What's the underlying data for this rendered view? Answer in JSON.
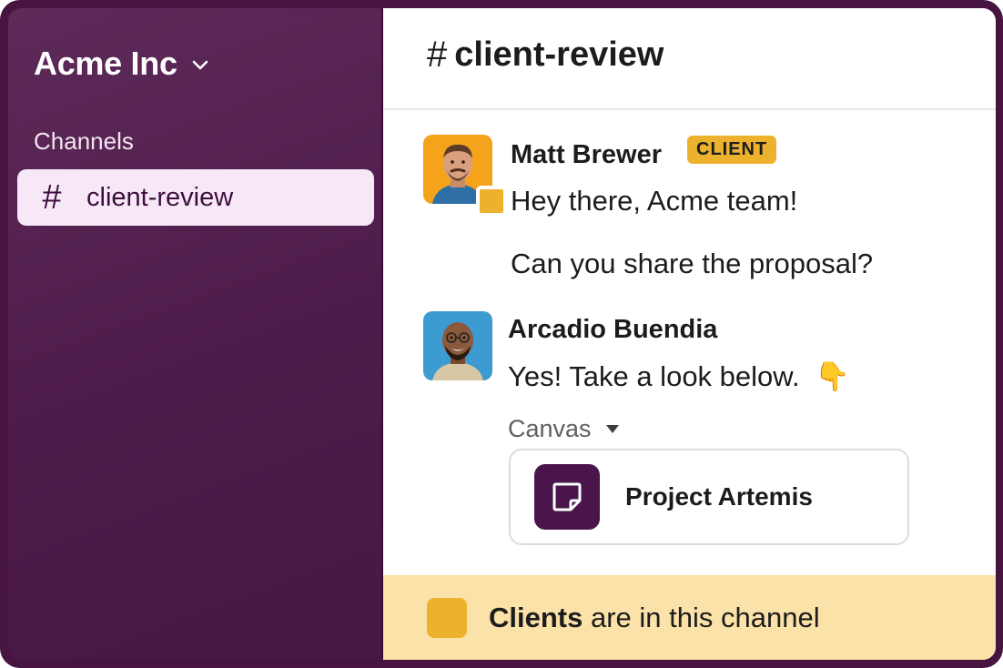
{
  "workspace": {
    "name": "Acme Inc"
  },
  "sidebar": {
    "section_label": "Channels",
    "channels": [
      {
        "hash": "#",
        "name": "client-review",
        "active": true
      }
    ]
  },
  "channel_header": {
    "hash": "#",
    "title": "client-review"
  },
  "messages": [
    {
      "author": "Matt Brewer",
      "tag": "CLIENT",
      "lines": [
        "Hey there, Acme team!",
        "Can you share the proposal?"
      ]
    },
    {
      "author": "Arcadio Buendia",
      "lines": [
        "Yes! Take a look below."
      ],
      "emoji": "👇",
      "attachment_toggle": "Canvas",
      "attachment": {
        "title": "Project Artemis"
      }
    }
  ],
  "footer": {
    "bold": "Clients",
    "rest": " are in this channel"
  },
  "colors": {
    "sidebar_bg": "#4e1c4a",
    "active_channel_bg": "#f6e8f6",
    "client_accent": "#ecb22e",
    "banner_bg": "#fbe2a8",
    "canvas_icon_bg": "#4a154b"
  }
}
